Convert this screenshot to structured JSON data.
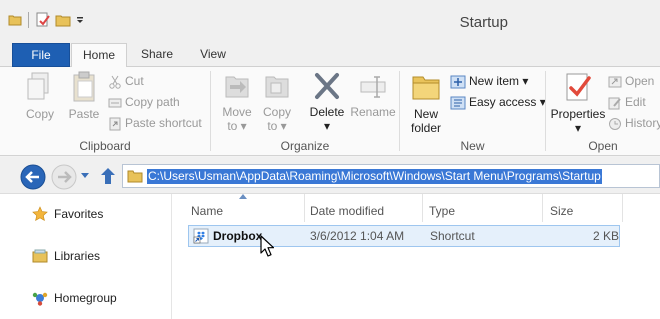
{
  "window": {
    "title": "Startup"
  },
  "ribbon_tabs": {
    "file": "File",
    "home": "Home",
    "share": "Share",
    "view": "View"
  },
  "clipboard": {
    "copy": "Copy",
    "paste": "Paste",
    "cut": "Cut",
    "copy_path": "Copy path",
    "paste_shortcut": "Paste shortcut",
    "group": "Clipboard"
  },
  "organize": {
    "move_to_line1": "Move",
    "move_to_line2": "to ▾",
    "copy_to_line1": "Copy",
    "copy_to_line2": "to ▾",
    "delete": "Delete",
    "delete_arrow": "▾",
    "rename": "Rename",
    "group": "Organize"
  },
  "new": {
    "new_folder_line1": "New",
    "new_folder_line2": "folder",
    "new_item": "New item ▾",
    "easy_access": "Easy access ▾",
    "group": "New"
  },
  "open": {
    "properties": "Properties",
    "properties_arrow": "▾",
    "open": "Open",
    "edit": "Edit",
    "history": "History",
    "group": "Open"
  },
  "address": {
    "path": "C:\\Users\\Usman\\AppData\\Roaming\\Microsoft\\Windows\\Start Menu\\Programs\\Startup"
  },
  "nav_pane": {
    "favorites": "Favorites",
    "libraries": "Libraries",
    "homegroup": "Homegroup"
  },
  "columns": {
    "name": "Name",
    "date": "Date modified",
    "type": "Type",
    "size": "Size"
  },
  "files": [
    {
      "name": "Dropbox",
      "date": "3/6/2012 1:04 AM",
      "type": "Shortcut",
      "size": "2 KB"
    }
  ],
  "colors": {
    "accent": "#1e5fb3",
    "selection": "#3a78d6",
    "row_hover": "#e5f0fb"
  }
}
